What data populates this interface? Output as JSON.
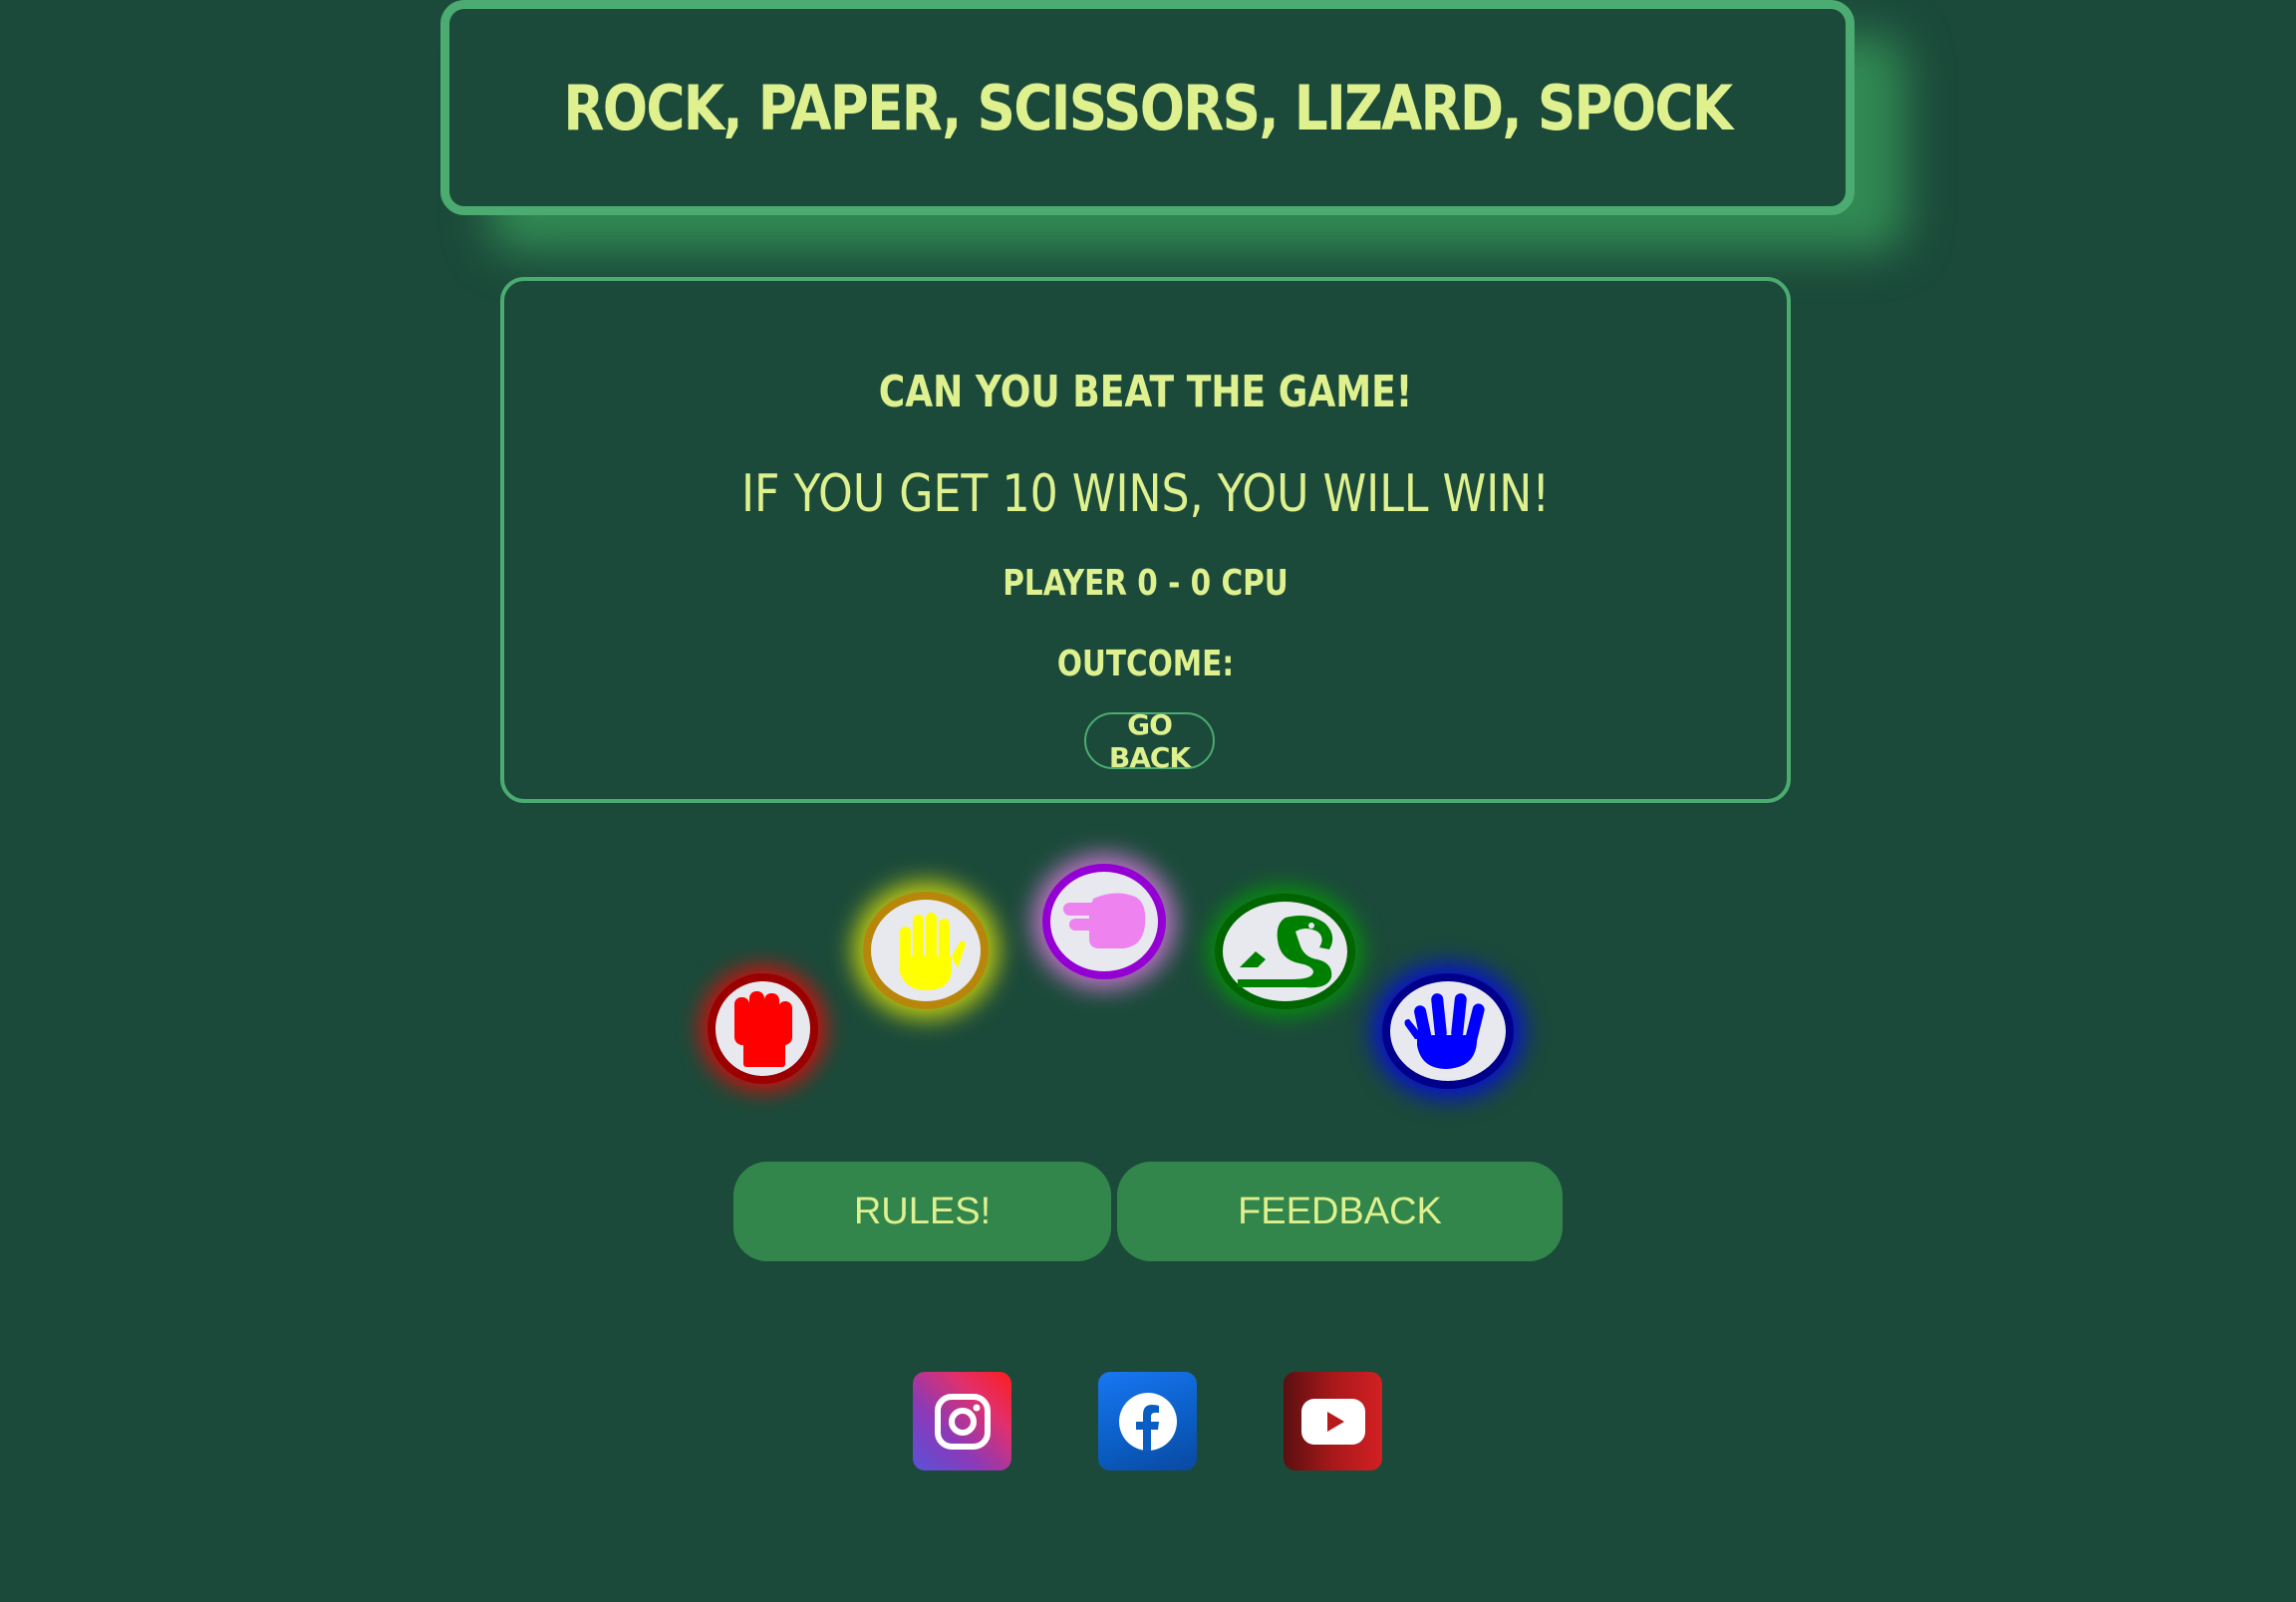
{
  "header": {
    "title": "ROCK, PAPER, SCISSORS, LIZARD, SPOCK"
  },
  "panel": {
    "heading": "CAN YOU BEAT THE GAME!",
    "subheading": "IF YOU GET 10 WINS, YOU WILL WIN!",
    "score_text": "PLAYER 0 - 0 CPU",
    "outcome_label": "OUTCOME:",
    "go_back_label": "GO BACK"
  },
  "choices": [
    {
      "name": "rock",
      "icon": "fist-icon",
      "color": "#ff0000",
      "ring": "#9b0000"
    },
    {
      "name": "paper",
      "icon": "hand-paper-icon",
      "color": "#ffff00",
      "ring": "#b8860b"
    },
    {
      "name": "scissors",
      "icon": "hand-scissors-icon",
      "color": "#ee82ee",
      "ring": "#9400d3"
    },
    {
      "name": "lizard",
      "icon": "lizard-icon",
      "color": "#008000",
      "ring": "#006400"
    },
    {
      "name": "spock",
      "icon": "hand-spock-icon",
      "color": "#0000ff",
      "ring": "#00008b"
    }
  ],
  "buttons": {
    "rules_label": "RULES!",
    "feedback_label": "FEEDBACK"
  },
  "social": [
    {
      "name": "instagram",
      "icon": "instagram-icon"
    },
    {
      "name": "facebook",
      "icon": "facebook-icon"
    },
    {
      "name": "youtube",
      "icon": "youtube-icon"
    }
  ],
  "colors": {
    "background": "#1b4a3a",
    "accent_border": "#4bab71",
    "text": "#dff08f",
    "button": "#32864c"
  }
}
